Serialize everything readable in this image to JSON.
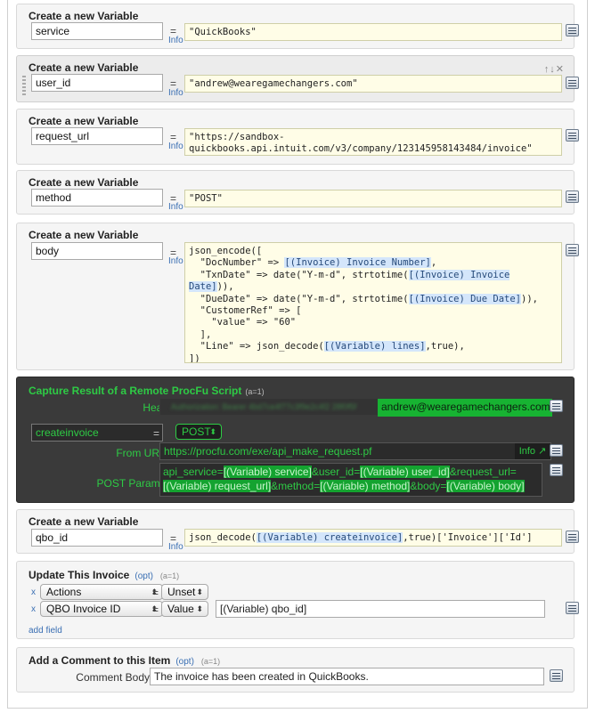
{
  "vars": [
    {
      "title": "Create a new Variable",
      "name": "service",
      "value": "\"QuickBooks\""
    },
    {
      "title": "Create a new Variable",
      "name": "user_id",
      "value": "\"andrew@wearegamechangers.com\""
    },
    {
      "title": "Create a new Variable",
      "name": "request_url",
      "value_line1": "\"https://sandbox-",
      "value_line2": "quickbooks.api.intuit.com/v3/company/123145958143484/invoice\""
    },
    {
      "title": "Create a new Variable",
      "name": "method",
      "value": "\"POST\""
    },
    {
      "title": "Create a new Variable",
      "name": "body"
    },
    {
      "title": "Create a new Variable",
      "name": "qbo_id"
    }
  ],
  "equals": "=",
  "info_label": "Info",
  "row_controls": "↑↓✕",
  "body_code": {
    "l1": "json_encode([",
    "l2a": "  \"DocNumber\" => ",
    "l2tok": "[(Invoice) Invoice Number]",
    "l2b": ",",
    "l3a": "  \"TxnDate\" => date(\"Y-m-d\", strtotime(",
    "l3tok": "[(Invoice) Invoice",
    "l3tok2": "Date]",
    "l3b": ")),",
    "l4a": "  \"DueDate\" => date(\"Y-m-d\", strtotime(",
    "l4tok": "[(Invoice) Due Date]",
    "l4b": ")),",
    "l5": "  \"CustomerRef\" => [",
    "l6": "    \"value\" => \"60\"",
    "l7": "  ],",
    "l8a": "  \"Line\" => json_decode(",
    "l8tok": "[(Variable) lines]",
    "l8b": ",true),",
    "l9": "])"
  },
  "qbo_code": {
    "a": "json_decode(",
    "tok": "[(Variable) createinvoice]",
    "b": ",true)['Invoice']['Id']"
  },
  "capture": {
    "title": "Capture Result of a Remote ProcFu Script",
    "count": "(a=1)",
    "headers_label": "Header(s):",
    "headers_blurred": "Authorization: Bearer 4bd7ce4f77c3f9e2c4f2 28f0f5f",
    "headers_value": "andrew@wearegamechangers.com",
    "var_name": "createinvoice",
    "method_value": "POST",
    "from_url_label": "From URL:",
    "url": "https://procfu.com/exe/api_make_request.pf",
    "info_btn": "Info ↗",
    "post_label": "POST Params:",
    "p1": "api_service=",
    "t1": "[(Variable) service]",
    "p2": "&user_id=",
    "t2": "[(Variable) user_id]",
    "p3": "&request_url=",
    "t3": "[(Variable) request_url]",
    "p4": "&method=",
    "t4": "[(Variable) method]",
    "p5": "&body=",
    "t5": "[(Variable) body]"
  },
  "update": {
    "title": "Update This Invoice",
    "opt": "(opt)",
    "count": "(a=1)",
    "row1_field": "Actions",
    "row1_mode": "Unset",
    "row2_field": "QBO Invoice ID",
    "row2_mode": "Value",
    "row2_value": "[(Variable) qbo_id]",
    "remove": "x",
    "add_field": "add field"
  },
  "comment": {
    "title": "Add a Comment to this Item",
    "opt": "(opt)",
    "count": "(a=1)",
    "label": "Comment Body",
    "value": "The invoice has been created in QuickBooks."
  }
}
